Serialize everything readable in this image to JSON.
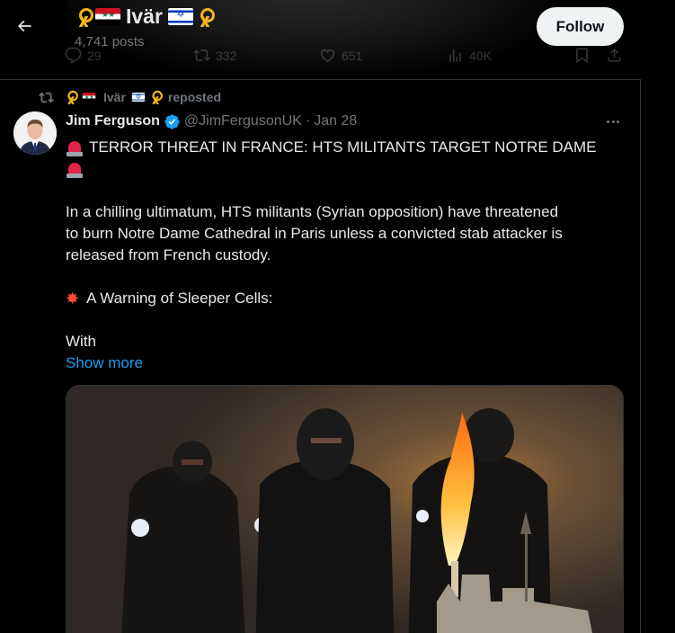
{
  "header": {
    "display_name": "Ivär",
    "posts_count": "4,741 posts",
    "follow_label": "Follow"
  },
  "previous_tweet_actions": {
    "replies": "29",
    "reposts": "332",
    "likes": "651",
    "views": "40K"
  },
  "repost_line": {
    "reposter": "Ivär",
    "verb": "reposted"
  },
  "tweet": {
    "author_name": "Jim Ferguson",
    "handle": "@JimFergusonUK",
    "separator": "·",
    "date": "Jan 28",
    "headline": "TERROR THREAT IN FRANCE: HTS MILITANTS TARGET NOTRE DAME",
    "body_line_1": "In a chilling ultimatum, HTS militants (Syrian opposition) have threatened",
    "body_line_2": "to burn Notre Dame Cathedral in Paris unless a convicted stab attacker is",
    "body_line_3": "released from French custody.",
    "subheading": "A Warning of Sleeper Cells:",
    "truncated_text": "With",
    "show_more_label": "Show more"
  },
  "colors": {
    "background": "#000000",
    "text_primary": "#e7e9ea",
    "text_secondary": "#71767b",
    "link": "#1d9bf0",
    "verified": "#1d9bf0",
    "border": "#2f3336",
    "ribbon": "#f4b31b",
    "siren": "#e0244a"
  },
  "icons": {
    "back": "arrow-left-icon",
    "reply": "reply-icon",
    "repost": "repost-icon",
    "like": "heart-icon",
    "views": "views-icon",
    "bookmark": "bookmark-icon",
    "share": "share-icon",
    "more": "more-icon",
    "verified": "verified-badge-icon",
    "ribbon": "yellow-ribbon-icon",
    "siren": "police-siren-icon",
    "collision": "collision-icon"
  }
}
